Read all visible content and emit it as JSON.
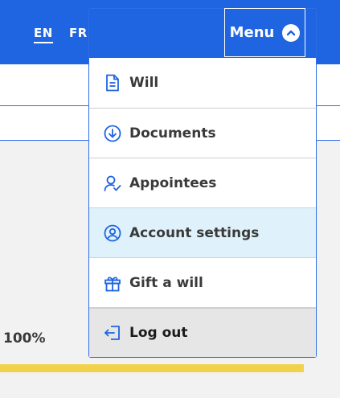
{
  "header": {
    "languages": [
      {
        "code": "EN",
        "active": true
      },
      {
        "code": "FR",
        "active": false
      }
    ]
  },
  "menu": {
    "button_label": "Menu",
    "items": [
      {
        "label": "Will",
        "icon": "document-icon"
      },
      {
        "label": "Documents",
        "icon": "download-circle-icon"
      },
      {
        "label": "Appointees",
        "icon": "user-check-icon"
      },
      {
        "label": "Account settings",
        "icon": "user-circle-icon",
        "active": true
      },
      {
        "label": "Gift a will",
        "icon": "gift-icon"
      },
      {
        "label": "Log out",
        "icon": "logout-icon"
      }
    ]
  },
  "progress": {
    "label": "100%",
    "value": 1.0
  },
  "colors": {
    "primary": "#1f64e0",
    "active_item_bg": "#dff2fb",
    "logout_bg": "#e6e6e6",
    "progress": "#f2d24a",
    "text": "#3a3a3a"
  }
}
